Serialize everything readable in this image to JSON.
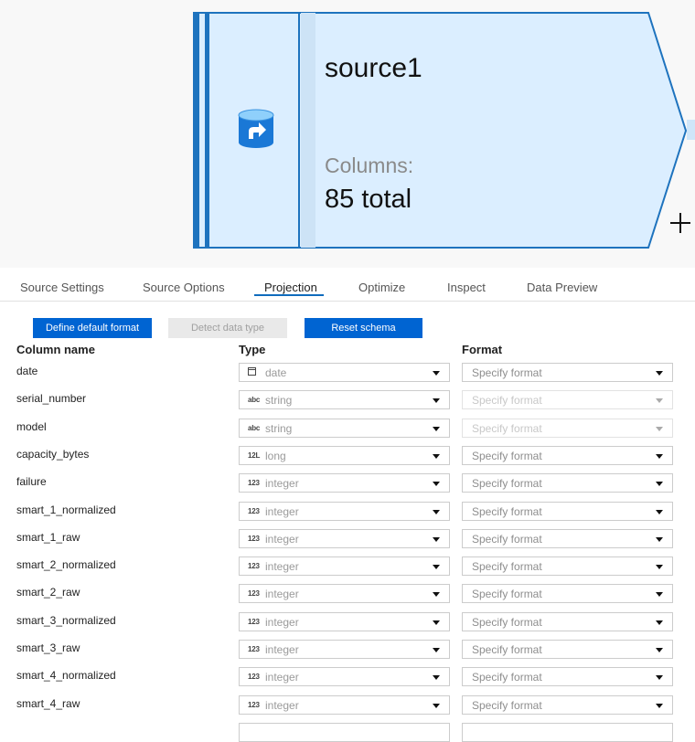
{
  "node": {
    "title": "source1",
    "columns_label": "Columns:",
    "columns_value": "85 total",
    "icon": "database-source-icon"
  },
  "tabs": [
    {
      "label": "Source Settings",
      "active": false
    },
    {
      "label": "Source Options",
      "active": false
    },
    {
      "label": "Projection",
      "active": true
    },
    {
      "label": "Optimize",
      "active": false
    },
    {
      "label": "Inspect",
      "active": false
    },
    {
      "label": "Data Preview",
      "active": false
    }
  ],
  "buttons": {
    "define_default_format": "Define default format",
    "detect_data_type": "Detect data type",
    "reset_schema": "Reset schema"
  },
  "headers": {
    "column_name": "Column name",
    "type": "Type",
    "format": "Format"
  },
  "colors": {
    "accent": "#0064d2",
    "node_fill": "#dbeeff",
    "node_border": "#1e73be"
  },
  "rows": [
    {
      "name": "date",
      "type": "date",
      "type_icon": "calendar-icon",
      "format": "Specify format",
      "format_enabled": true
    },
    {
      "name": "serial_number",
      "type": "string",
      "type_icon": "abc",
      "format": "Specify format",
      "format_enabled": false
    },
    {
      "name": "model",
      "type": "string",
      "type_icon": "abc",
      "format": "Specify format",
      "format_enabled": false
    },
    {
      "name": "capacity_bytes",
      "type": "long",
      "type_icon": "12L",
      "format": "Specify format",
      "format_enabled": true
    },
    {
      "name": "failure",
      "type": "integer",
      "type_icon": "123",
      "format": "Specify format",
      "format_enabled": true
    },
    {
      "name": "smart_1_normalized",
      "type": "integer",
      "type_icon": "123",
      "format": "Specify format",
      "format_enabled": true
    },
    {
      "name": "smart_1_raw",
      "type": "integer",
      "type_icon": "123",
      "format": "Specify format",
      "format_enabled": true
    },
    {
      "name": "smart_2_normalized",
      "type": "integer",
      "type_icon": "123",
      "format": "Specify format",
      "format_enabled": true
    },
    {
      "name": "smart_2_raw",
      "type": "integer",
      "type_icon": "123",
      "format": "Specify format",
      "format_enabled": true
    },
    {
      "name": "smart_3_normalized",
      "type": "integer",
      "type_icon": "123",
      "format": "Specify format",
      "format_enabled": true
    },
    {
      "name": "smart_3_raw",
      "type": "integer",
      "type_icon": "123",
      "format": "Specify format",
      "format_enabled": true
    },
    {
      "name": "smart_4_normalized",
      "type": "integer",
      "type_icon": "123",
      "format": "Specify format",
      "format_enabled": true
    },
    {
      "name": "smart_4_raw",
      "type": "integer",
      "type_icon": "123",
      "format": "Specify format",
      "format_enabled": true
    }
  ]
}
